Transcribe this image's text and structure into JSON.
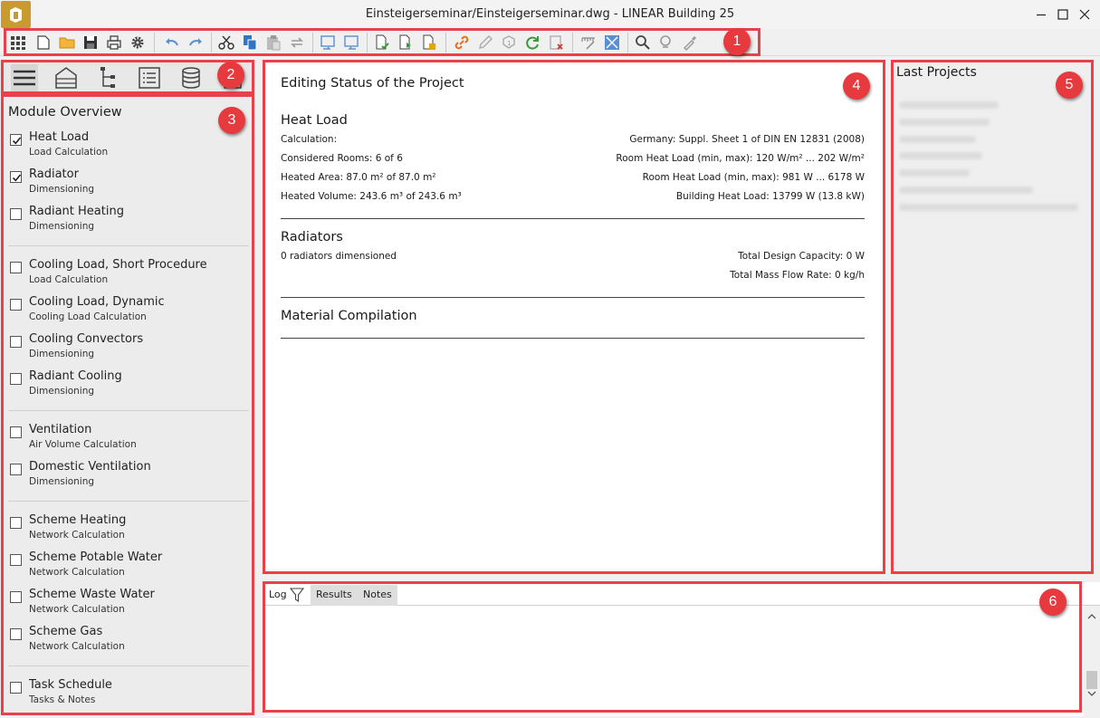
{
  "window": {
    "title": "Einsteigerseminar/Einsteigerseminar.dwg - LINEAR Building 25",
    "logo_icon": "linear-logo-icon",
    "controls": [
      "minimize-icon",
      "maximize-icon",
      "close-icon"
    ]
  },
  "toolbar": {
    "icons": [
      "apps-grid-icon",
      "new-document-icon",
      "open-folder-icon",
      "save-icon",
      "print-icon",
      "settings-gear-icon",
      "undo-icon",
      "redo-icon",
      "cut-icon",
      "copy-icon",
      "paste-icon",
      "transfer-icon",
      "import-icon",
      "export-icon",
      "document-check-icon",
      "document-refresh-icon",
      "document-calc-icon",
      "link-icon",
      "edit-pen-icon",
      "info-badge-icon",
      "refresh-icon",
      "delete-icon",
      "measure-icon",
      "check-icon",
      "zoom-icon",
      "zoom-alt-icon",
      "eyedropper-icon"
    ]
  },
  "callouts": [
    "1",
    "2",
    "3",
    "4",
    "5",
    "6"
  ],
  "left_tabs": [
    "menu-icon",
    "building-icon",
    "network-icon",
    "list-icon",
    "database-icon",
    "more-icon"
  ],
  "modules": {
    "title": "Module Overview",
    "items": [
      {
        "name": "Heat Load",
        "sub": "Load Calculation",
        "checked": true
      },
      {
        "name": "Radiator",
        "sub": "Dimensioning",
        "checked": true
      },
      {
        "name": "Radiant Heating",
        "sub": "Dimensioning",
        "checked": false
      },
      {
        "name": "Cooling Load, Short Procedure",
        "sub": "Load Calculation",
        "checked": false
      },
      {
        "name": "Cooling Load, Dynamic",
        "sub": "Cooling Load Calculation",
        "checked": false
      },
      {
        "name": "Cooling Convectors",
        "sub": "Dimensioning",
        "checked": false
      },
      {
        "name": "Radiant Cooling",
        "sub": "Dimensioning",
        "checked": false
      },
      {
        "name": "Ventilation",
        "sub": "Air Volume Calculation",
        "checked": false
      },
      {
        "name": "Domestic Ventilation",
        "sub": "Dimensioning",
        "checked": false
      },
      {
        "name": "Scheme Heating",
        "sub": "Network Calculation",
        "checked": false
      },
      {
        "name": "Scheme Potable Water",
        "sub": "Network Calculation",
        "checked": false
      },
      {
        "name": "Scheme Waste Water",
        "sub": "Network Calculation",
        "checked": false
      },
      {
        "name": "Scheme Gas",
        "sub": "Network Calculation",
        "checked": false
      },
      {
        "name": "Task Schedule",
        "sub": "Tasks & Notes",
        "checked": false
      }
    ]
  },
  "main": {
    "title": "Editing Status of the Project",
    "heat_load": {
      "title": "Heat Load",
      "calculation_label": "Calculation:",
      "calculation_value": "Germany: Suppl. Sheet 1 of DIN EN 12831 (2008)",
      "rooms": "Considered Rooms: 6 of 6",
      "room_heat_load": "Room Heat Load (min, max): 120 W/m² ... 202 W/m²",
      "area": "Heated Area: 87.0 m² of 87.0 m²",
      "room_heat_load_w": "Room Heat Load (min, max): 981 W ... 6178 W",
      "volume": "Heated Volume: 243.6 m³ of 243.6 m³",
      "building_heat_load": "Building Heat Load: 13799 W (13.8 kW)"
    },
    "radiators": {
      "title": "Radiators",
      "dimensioned": "0 radiators dimensioned",
      "capacity": "Total Design Capacity: 0 W",
      "mass_flow": "Total Mass Flow Rate: 0 kg/h"
    },
    "material": {
      "title": "Material Compilation"
    }
  },
  "last_projects": {
    "title": "Last Projects"
  },
  "log": {
    "tabs": [
      "Log",
      "Results",
      "Notes"
    ],
    "filter_icon": "filter-icon"
  }
}
